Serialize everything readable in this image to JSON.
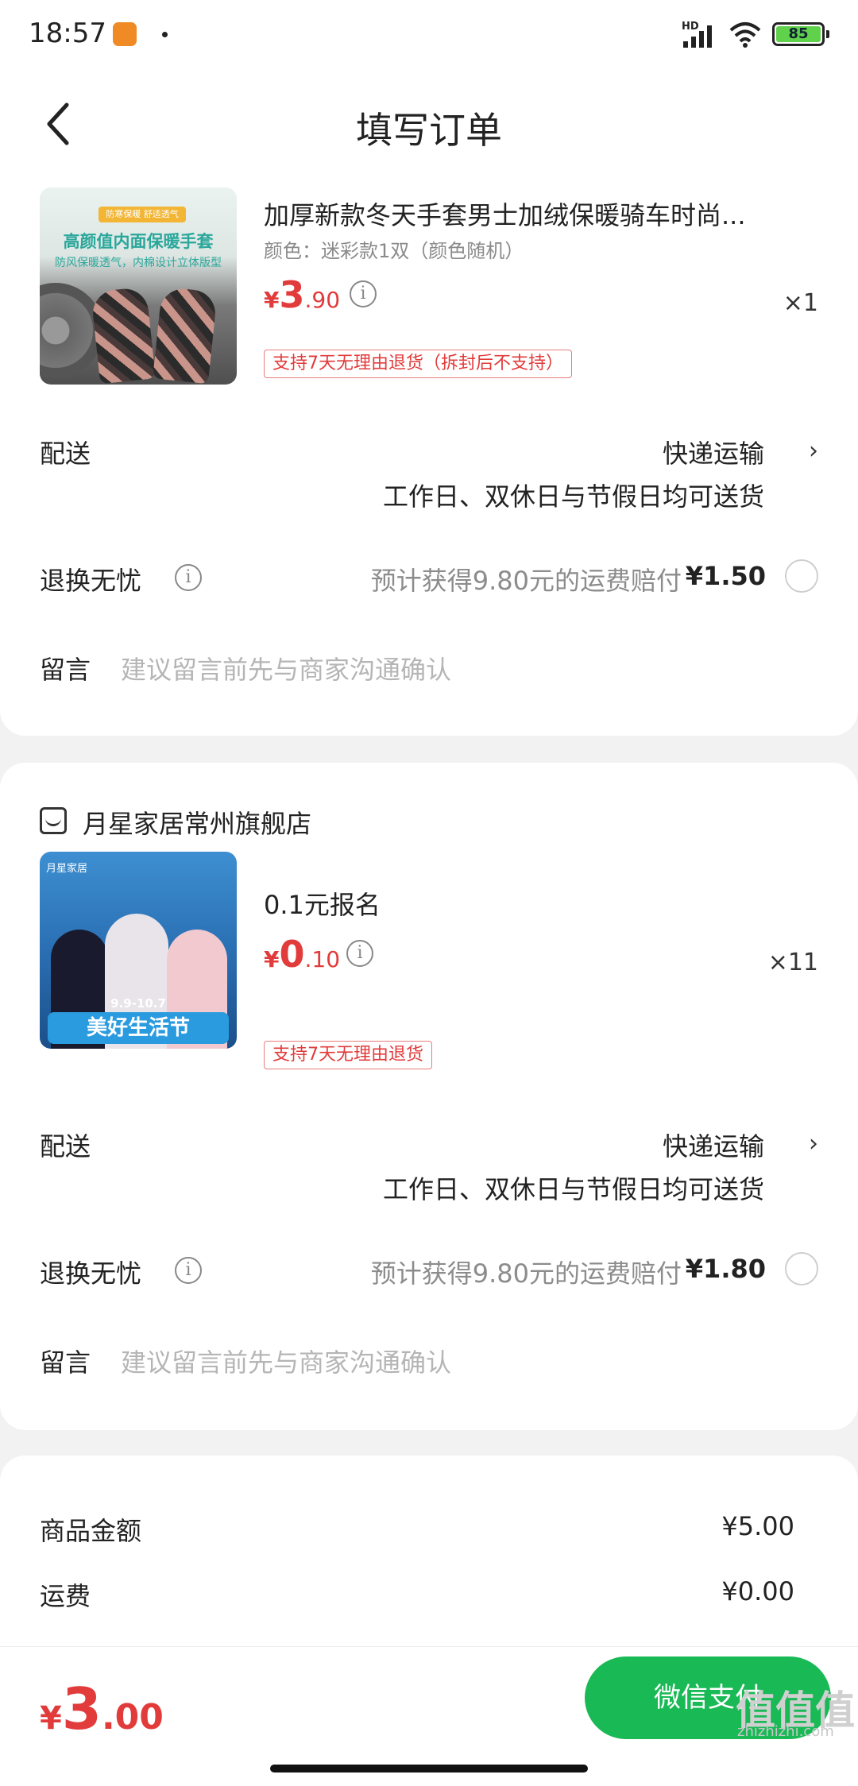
{
  "status_bar": {
    "time": "18:57",
    "network": "HD",
    "battery": "85",
    "accent_green": "#5fd14a"
  },
  "header": {
    "title": "填写订单",
    "back_icon": "chevron-left-icon"
  },
  "order1": {
    "product": {
      "thumb_tag": "防寒保暖 舒适透气",
      "thumb_heading": "高颜值内面保暖手套",
      "thumb_sub": "防风保暖透气，内棉设计立体版型",
      "title": "加厚新款冬天手套男士加绒保暖骑车时尚...",
      "spec": "颜色：迷彩款1双（颜色随机）",
      "price_currency": "¥",
      "price_int": "3",
      "price_dec": ".90",
      "qty": "×1",
      "return_tag": "支持7天无理由退货（拆封后不支持）"
    },
    "delivery": {
      "label": "配送",
      "method": "快递运输",
      "note": "工作日、双休日与节假日均可送货"
    },
    "return_insurance": {
      "label": "退换无忧",
      "desc": "预计获得9.80元的运费赔付",
      "fee": "¥1.50"
    },
    "message": {
      "label": "留言",
      "placeholder": "建议留言前先与商家沟通确认"
    }
  },
  "order2": {
    "store_name": "月星家居常州旗舰店",
    "product": {
      "thumb_brand": "月星家居",
      "thumb_date": "9.9-10.7",
      "thumb_banner": "美好生活节",
      "title": "0.1元报名",
      "price_currency": "¥",
      "price_int": "0",
      "price_dec": ".10",
      "qty": "×11",
      "return_tag": "支持7天无理由退货"
    },
    "delivery": {
      "label": "配送",
      "method": "快递运输",
      "note": "工作日、双休日与节假日均可送货"
    },
    "return_insurance": {
      "label": "退换无忧",
      "desc": "预计获得9.80元的运费赔付",
      "fee": "¥1.80"
    },
    "message": {
      "label": "留言",
      "placeholder": "建议留言前先与商家沟通确认"
    }
  },
  "summary": {
    "goods_label": "商品金额",
    "goods_value": "¥5.00",
    "shipping_label": "运费",
    "shipping_value": "¥0.00"
  },
  "footer": {
    "total_currency": "¥",
    "total_int": "3",
    "total_dec": ".00",
    "pay_label": "微信支付",
    "pay_color": "#19b955",
    "price_color": "#e23b3b",
    "watermark": "值值值",
    "watermark_url": "zhizhizhi.com"
  }
}
